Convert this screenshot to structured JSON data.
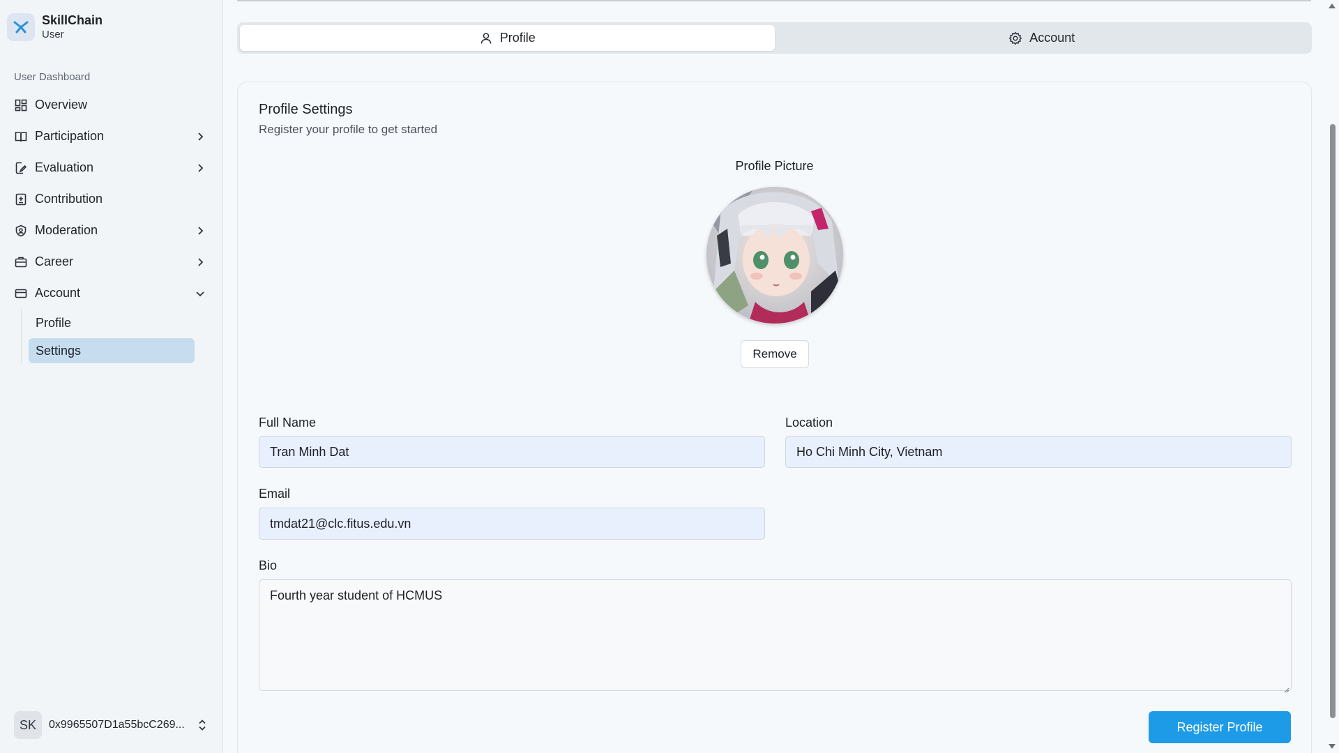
{
  "brand": {
    "name": "SkillChain",
    "role": "User",
    "logo_icon": "skillchain-logo-icon",
    "accent": "#1e9be6"
  },
  "sidebar": {
    "section_label": "User Dashboard",
    "items": [
      {
        "label": "Overview",
        "icon": "dashboard-grid-icon",
        "expandable": false
      },
      {
        "label": "Participation",
        "icon": "book-open-icon",
        "expandable": true
      },
      {
        "label": "Evaluation",
        "icon": "file-edit-icon",
        "expandable": true
      },
      {
        "label": "Contribution",
        "icon": "square-plus-icon",
        "expandable": false
      },
      {
        "label": "Moderation",
        "icon": "shield-icon",
        "expandable": true
      },
      {
        "label": "Career",
        "icon": "briefcase-icon",
        "expandable": true
      },
      {
        "label": "Account",
        "icon": "card-icon",
        "expandable": true,
        "expanded": true
      }
    ],
    "account_subitems": [
      {
        "label": "Profile",
        "active": false
      },
      {
        "label": "Settings",
        "active": true
      }
    ],
    "footer": {
      "initials": "SK",
      "wallet": "0x9965507D1a55bcC269..."
    }
  },
  "tabs": [
    {
      "label": "Profile",
      "icon": "user-icon",
      "active": true
    },
    {
      "label": "Account",
      "icon": "gear-icon",
      "active": false
    }
  ],
  "profile_card": {
    "title": "Profile Settings",
    "subtitle": "Register your profile to get started",
    "picture_label": "Profile Picture",
    "remove_label": "Remove",
    "full_name_label": "Full Name",
    "full_name_value": "Tran Minh Dat",
    "location_label": "Location",
    "location_value": "Ho Chi Minh City, Vietnam",
    "email_label": "Email",
    "email_value": "tmdat21@clc.fitus.edu.vn",
    "bio_label": "Bio",
    "bio_value": "Fourth year student of HCMUS",
    "submit_label": "Register Profile"
  }
}
